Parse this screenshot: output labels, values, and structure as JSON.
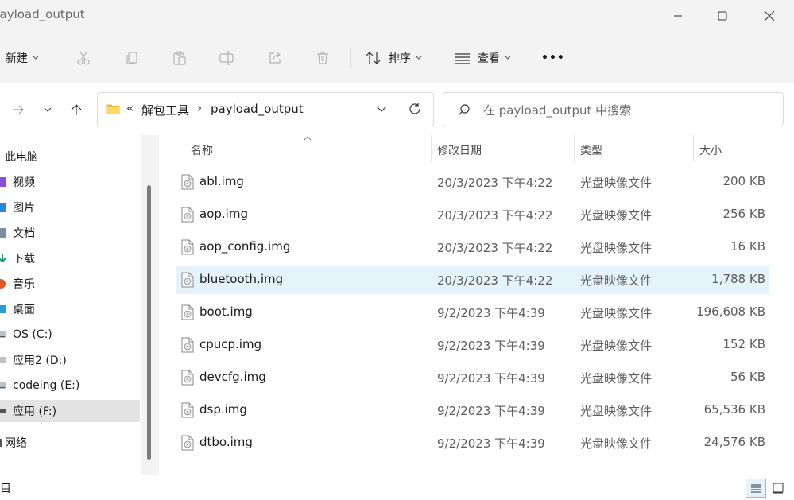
{
  "window": {
    "title": "payload_output"
  },
  "toolbar": {
    "new_label": "新建",
    "sort_label": "排序",
    "view_label": "查看",
    "more_label": "•••"
  },
  "address": {
    "overflow": "«",
    "crumbs": [
      "解包工具",
      "payload_output"
    ],
    "separator": "›"
  },
  "search": {
    "placeholder": "在 payload_output 中搜索"
  },
  "sidebar": {
    "items": [
      {
        "label": "此电脑",
        "icon": "this-pc-icon"
      },
      {
        "label": "视频",
        "icon": "video-icon"
      },
      {
        "label": "图片",
        "icon": "pictures-icon"
      },
      {
        "label": "文档",
        "icon": "documents-icon"
      },
      {
        "label": "下载",
        "icon": "download-icon"
      },
      {
        "label": "音乐",
        "icon": "music-icon"
      },
      {
        "label": "桌面",
        "icon": "desktop-icon"
      },
      {
        "label": "OS (C:)",
        "icon": "drive-icon"
      },
      {
        "label": "应用2 (D:)",
        "icon": "drive-icon"
      },
      {
        "label": "codeing (E:)",
        "icon": "drive-icon"
      },
      {
        "label": "应用 (F:)",
        "icon": "drive-icon",
        "selected": true
      },
      {
        "label": "网络",
        "icon": "network-icon"
      }
    ]
  },
  "columns": {
    "name": "名称",
    "date": "修改日期",
    "type": "类型",
    "size": "大小"
  },
  "files": [
    {
      "name": "abl.img",
      "date": "20/3/2023 下午4:22",
      "type": "光盘映像文件",
      "size": "200 KB"
    },
    {
      "name": "aop.img",
      "date": "20/3/2023 下午4:22",
      "type": "光盘映像文件",
      "size": "256 KB"
    },
    {
      "name": "aop_config.img",
      "date": "20/3/2023 下午4:22",
      "type": "光盘映像文件",
      "size": "16 KB"
    },
    {
      "name": "bluetooth.img",
      "date": "20/3/2023 下午4:22",
      "type": "光盘映像文件",
      "size": "1,788 KB",
      "selected": true
    },
    {
      "name": "boot.img",
      "date": "9/2/2023 下午4:39",
      "type": "光盘映像文件",
      "size": "196,608 KB"
    },
    {
      "name": "cpucp.img",
      "date": "9/2/2023 下午4:39",
      "type": "光盘映像文件",
      "size": "152 KB"
    },
    {
      "name": "devcfg.img",
      "date": "9/2/2023 下午4:39",
      "type": "光盘映像文件",
      "size": "56 KB"
    },
    {
      "name": "dsp.img",
      "date": "9/2/2023 下午4:39",
      "type": "光盘映像文件",
      "size": "65,536 KB"
    },
    {
      "name": "dtbo.img",
      "date": "9/2/2023 下午4:39",
      "type": "光盘映像文件",
      "size": "24,576 KB"
    }
  ],
  "status": {
    "text": "项目"
  },
  "colors": {
    "accent": "#0067c0",
    "selected_row": "#e5f3fb",
    "selected_nav": "#e3e3e3",
    "folder": "#f4c542"
  }
}
